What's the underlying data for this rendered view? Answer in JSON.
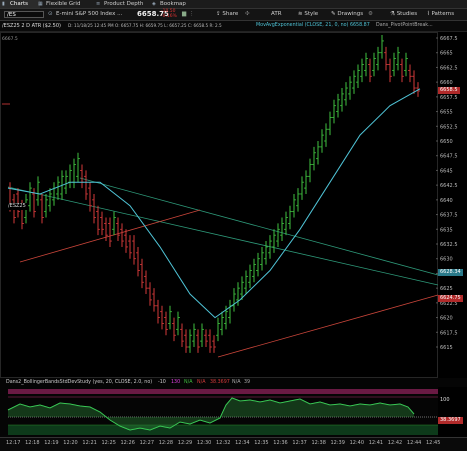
{
  "tabs": [
    {
      "icon": "chart-icon",
      "label": "Charts",
      "active": true
    },
    {
      "icon": "grid-icon",
      "label": "Flexible Grid",
      "active": false
    },
    {
      "icon": "depth-icon",
      "label": "Product Depth",
      "active": false
    },
    {
      "icon": "bookmap-icon",
      "label": "Bookmap",
      "active": false
    }
  ],
  "toolbar": {
    "symbol": "/ES",
    "description": "E-mini S&P 500 Index ...",
    "last_price": "6658.75",
    "change_top": "-10.50",
    "change_bottom": "-0.16%",
    "share": "Share",
    "atr": "ATR",
    "style": "Style",
    "drawings": "Drawings",
    "studies": "Studies",
    "patterns": "Patterns"
  },
  "studybar": {
    "symbol_tag": "/ESZ25 2 D ATR ($2.50)",
    "ohlc": "D: 11/18/25 12:45 PM  O: 6657.75  H: 6659.75  L: 6657.25  C: 6658.5  R: 2.5",
    "ma_label": "MovAvgExponential (CLOSE, 21, 0, no)",
    "ma_value": "6658.87",
    "pivot_label": "Dans_PivotPointBreak..."
  },
  "price_axis": {
    "ticks": [
      "6667.5",
      "6665",
      "6662.5",
      "6660",
      "6657.5",
      "6655",
      "6652.5",
      "6650",
      "6647.5",
      "6645",
      "6642.5",
      "6640",
      "6637.5",
      "6635",
      "6632.5",
      "6630",
      "6627.5",
      "6625",
      "6622.5",
      "6620",
      "6617.5",
      "6615"
    ],
    "tag_last": "6658.5",
    "tag_green": "6628.34",
    "tag_red": "6624.75",
    "tag_left": "/ESZ25",
    "left_tick": "6667.5"
  },
  "lower_study": {
    "label": "Dans2_BollingerBandsStdDevStudy (yes, 20, CLOSE, 2.0, no)",
    "fields": [
      "-10",
      "130",
      "N/A",
      "N/A",
      "38.3697",
      "N/A",
      "39"
    ],
    "value_tag_top": "100",
    "value_tag_mid": "38.3697"
  },
  "time_axis": [
    "12:17",
    "12:18",
    "12:19",
    "12:20",
    "12:21",
    "12:25",
    "12:26",
    "12:27",
    "12:28",
    "12:29",
    "12:30",
    "12:32",
    "12:34",
    "12:35",
    "12:36",
    "12:37",
    "12:38",
    "12:39",
    "12:40",
    "12:41",
    "12:42",
    "12:44",
    "12:45"
  ],
  "colors": {
    "up": "#3fbf3f",
    "down": "#d33a3a",
    "ma": "#4fc3d6",
    "trend_green": "#2e9a7a",
    "trend_red": "#c9453a"
  }
}
